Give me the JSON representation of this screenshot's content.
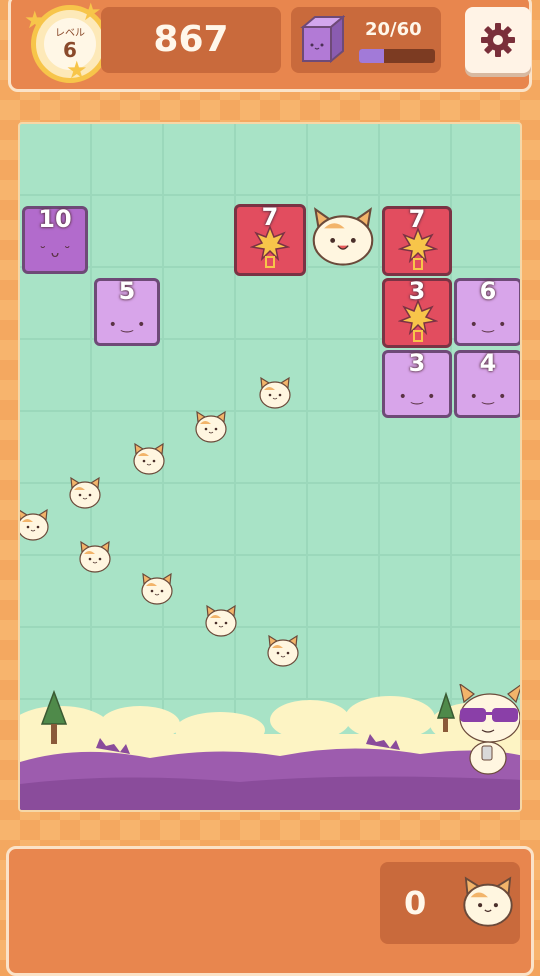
{
  "hud": {
    "level_label": "レベル",
    "level": "6",
    "score": "867",
    "blocks_text": "20/60",
    "blocks_progress": 0.33
  },
  "board": {
    "blocks": [
      {
        "number": "10",
        "type": "purple-dark",
        "face": "˘ ᴗ ˘"
      },
      {
        "number": "5",
        "type": "purple",
        "face": "• ‿ •"
      },
      {
        "number": "7",
        "type": "red-bomb"
      },
      {
        "number": "7",
        "type": "red-bomb"
      },
      {
        "number": "3",
        "type": "red-bomb"
      },
      {
        "number": "6",
        "type": "purple",
        "face": "• ‿ •"
      },
      {
        "number": "3",
        "type": "purple",
        "face": "• ‿ •"
      },
      {
        "number": "4",
        "type": "purple",
        "face": "• ‿ •"
      }
    ]
  },
  "footer": {
    "balls_count": "0"
  },
  "colors": {
    "board": "#a8e3c6",
    "bar": "#e8864e",
    "purple": "#d8a5ea",
    "red": "#e24d5f"
  }
}
